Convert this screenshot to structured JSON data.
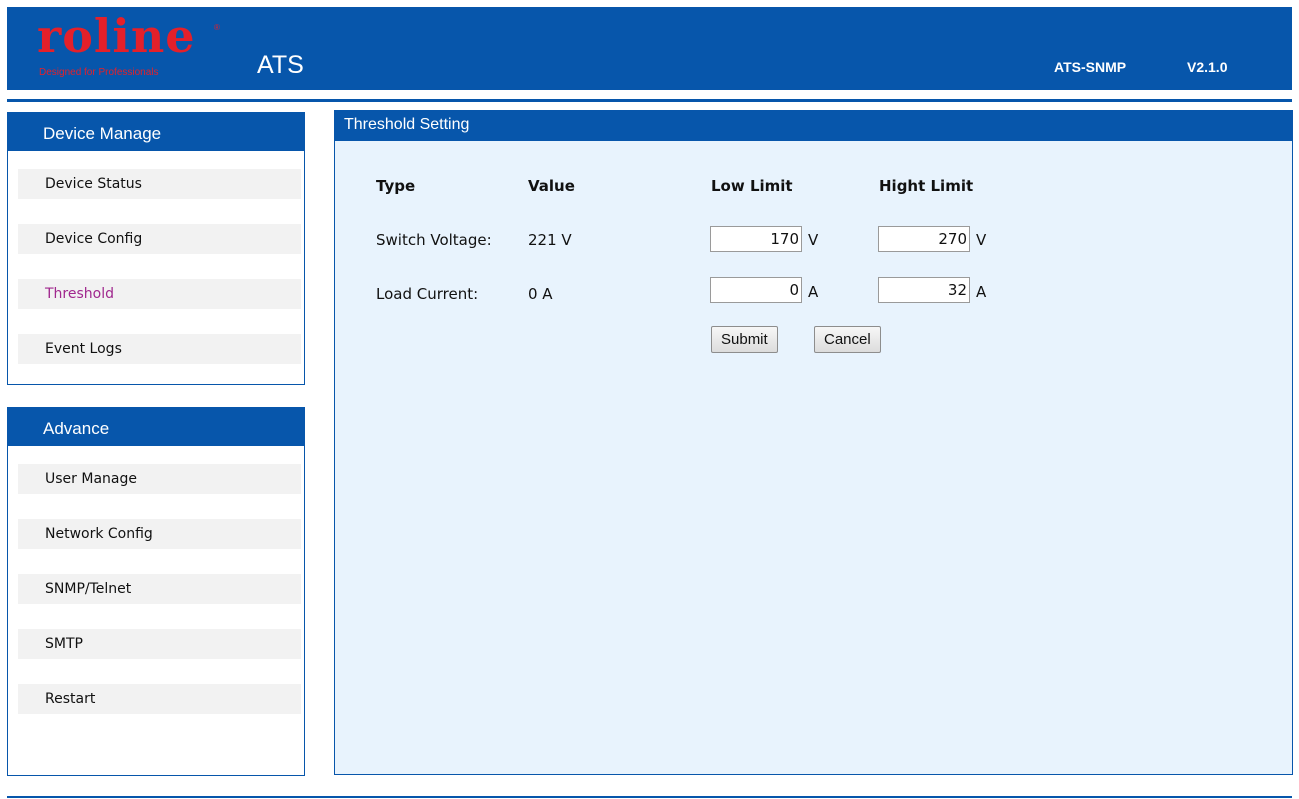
{
  "header": {
    "logo_text": "roline",
    "logo_tagline": "Designed for Professionals",
    "logo_reg": "®",
    "app_title": "ATS",
    "model": "ATS-SNMP",
    "version": "V2.1.0"
  },
  "sidebar": {
    "sections": [
      {
        "title": "Device Manage",
        "items": [
          {
            "label": "Device Status",
            "active": false
          },
          {
            "label": "Device Config",
            "active": false
          },
          {
            "label": "Threshold",
            "active": true
          },
          {
            "label": "Event Logs",
            "active": false
          }
        ]
      },
      {
        "title": "Advance",
        "items": [
          {
            "label": "User Manage",
            "active": false
          },
          {
            "label": "Network Config",
            "active": false
          },
          {
            "label": "SNMP/Telnet",
            "active": false
          },
          {
            "label": "SMTP",
            "active": false
          },
          {
            "label": "Restart",
            "active": false
          }
        ]
      }
    ]
  },
  "main": {
    "title": "Threshold Setting",
    "columns": [
      "Type",
      "Value",
      "Low Limit",
      "Hight Limit"
    ],
    "rows": [
      {
        "type": "Switch Voltage:",
        "value": "221 V",
        "low": "170",
        "low_unit": "V",
        "high": "270",
        "high_unit": "V"
      },
      {
        "type": "Load Current:",
        "value": "0 A",
        "low": "0",
        "low_unit": "A",
        "high": "32",
        "high_unit": "A"
      }
    ],
    "buttons": {
      "submit": "Submit",
      "cancel": "Cancel"
    }
  },
  "colors": {
    "brand_blue": "#0756ab",
    "logo_red": "#e4202a",
    "active_link": "#a0288e",
    "content_bg": "#e8f3fd"
  }
}
